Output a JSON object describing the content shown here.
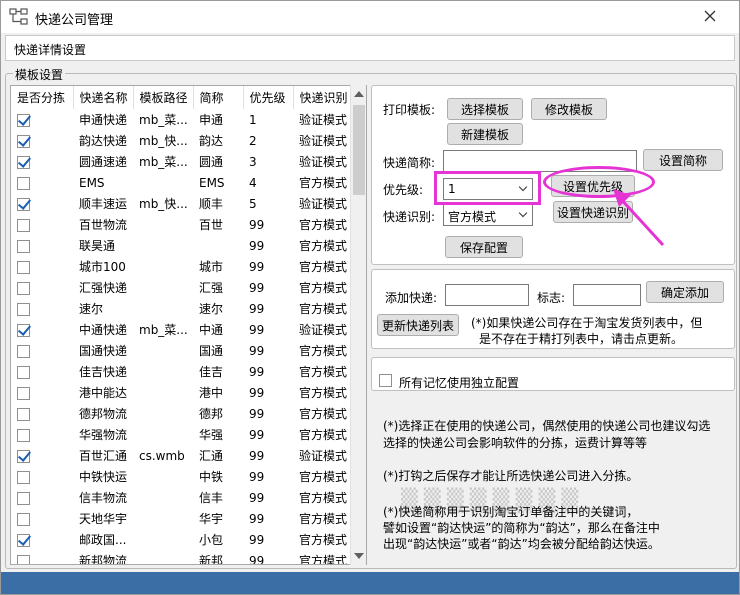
{
  "window": {
    "title": "快递公司管理",
    "icon": "app-tree-icon"
  },
  "header": {
    "label": "快递详情设置"
  },
  "template_group": {
    "title": "模板设置"
  },
  "table": {
    "columns": [
      "是否分拣",
      "快递名称",
      "模板路径",
      "简称",
      "优先级",
      "快递识别"
    ],
    "rows": [
      {
        "checked": true,
        "name": "申通快递",
        "path": "mb_菜...",
        "abbr": "申通",
        "priority": "1",
        "mode": "验证模式"
      },
      {
        "checked": true,
        "name": "韵达快递",
        "path": "mb_快...",
        "abbr": "韵达",
        "priority": "2",
        "mode": "验证模式"
      },
      {
        "checked": true,
        "name": "圆通速递",
        "path": "mb_菜...",
        "abbr": "圆通",
        "priority": "3",
        "mode": "验证模式"
      },
      {
        "checked": false,
        "name": "EMS",
        "path": "",
        "abbr": "EMS",
        "priority": "4",
        "mode": "官方模式"
      },
      {
        "checked": true,
        "name": "顺丰速运",
        "path": "mb_快...",
        "abbr": "顺丰",
        "priority": "5",
        "mode": "验证模式"
      },
      {
        "checked": false,
        "name": "百世物流",
        "path": "",
        "abbr": "百世",
        "priority": "99",
        "mode": "官方模式"
      },
      {
        "checked": false,
        "name": "联昊通",
        "path": "",
        "abbr": "",
        "priority": "99",
        "mode": "官方模式"
      },
      {
        "checked": false,
        "name": "城市100",
        "path": "",
        "abbr": "城市",
        "priority": "99",
        "mode": "官方模式"
      },
      {
        "checked": false,
        "name": "汇强快递",
        "path": "",
        "abbr": "汇强",
        "priority": "99",
        "mode": "官方模式"
      },
      {
        "checked": false,
        "name": "速尔",
        "path": "",
        "abbr": "速尔",
        "priority": "99",
        "mode": "官方模式"
      },
      {
        "checked": true,
        "name": "中通快递",
        "path": "mb_菜...",
        "abbr": "中通",
        "priority": "99",
        "mode": "验证模式"
      },
      {
        "checked": false,
        "name": "国通快递",
        "path": "",
        "abbr": "国通",
        "priority": "99",
        "mode": "官方模式"
      },
      {
        "checked": false,
        "name": "佳吉快递",
        "path": "",
        "abbr": "佳吉",
        "priority": "99",
        "mode": "官方模式"
      },
      {
        "checked": false,
        "name": "港中能达",
        "path": "",
        "abbr": "港中",
        "priority": "99",
        "mode": "官方模式"
      },
      {
        "checked": false,
        "name": "德邦物流",
        "path": "",
        "abbr": "德邦",
        "priority": "99",
        "mode": "官方模式"
      },
      {
        "checked": false,
        "name": "华强物流",
        "path": "",
        "abbr": "华强",
        "priority": "99",
        "mode": "官方模式"
      },
      {
        "checked": true,
        "name": "百世汇通",
        "path": "cs.wmb",
        "abbr": "汇通",
        "priority": "99",
        "mode": "验证模式"
      },
      {
        "checked": false,
        "name": "中铁快运",
        "path": "",
        "abbr": "中铁",
        "priority": "99",
        "mode": "官方模式"
      },
      {
        "checked": false,
        "name": "信丰物流",
        "path": "",
        "abbr": "信丰",
        "priority": "99",
        "mode": "官方模式"
      },
      {
        "checked": false,
        "name": "天地华宇",
        "path": "",
        "abbr": "华宇",
        "priority": "99",
        "mode": "官方模式"
      },
      {
        "checked": true,
        "name": "邮政国...",
        "path": "",
        "abbr": "小包",
        "priority": "99",
        "mode": "官方模式"
      },
      {
        "checked": false,
        "name": "新邦物流",
        "path": "",
        "abbr": "新邦",
        "priority": "99",
        "mode": "官方模式"
      }
    ]
  },
  "print_panel": {
    "print_template_label": "打印模板:",
    "select_template": "选择模板",
    "modify_template": "修改模板",
    "new_template": "新建模板",
    "abbr_label": "快递简称:",
    "abbr_value": "",
    "set_abbr": "设置简称",
    "priority_label": "优先级:",
    "priority_value": "1",
    "set_priority": "设置优先级",
    "recognition_label": "快递识别:",
    "recognition_value": "官方模式",
    "set_recognition": "设置快递识别",
    "save_config": "保存配置"
  },
  "add_panel": {
    "add_label": "添加快递:",
    "add_value": "",
    "mark_label": "标志:",
    "mark_value": "",
    "confirm_add": "确定添加",
    "update_list": "更新快递列表",
    "hint_line1": "(*)如果快递公司存在于淘宝发货列表中，但",
    "hint_line2": "是不存在于精打列表中，请击点更新。"
  },
  "memory_panel": {
    "checkbox_label": "所有记忆使用独立配置",
    "checked": false
  },
  "notes": {
    "line1": "(*)选择正在使用的快递公司，偶然使用的快递公司也建议勾选",
    "line2": "选择的快递公司会影响软件的分拣，运费计算等等",
    "line3": "(*)打钩之后保存才能让所选快递公司进入分拣。",
    "line4": "(*)快递简称用于识别淘宝订单备注中的关键词，",
    "line5": "譬如设置“韵达快运”的简称为“韵达”，那么在备注中",
    "line6": "出现“韵达快运”或者“韵达”均会被分配给韵达快运。"
  },
  "colors": {
    "highlight": "#e533d4",
    "statusbar": "#3b6ea5",
    "check": "#1a5fb4"
  }
}
